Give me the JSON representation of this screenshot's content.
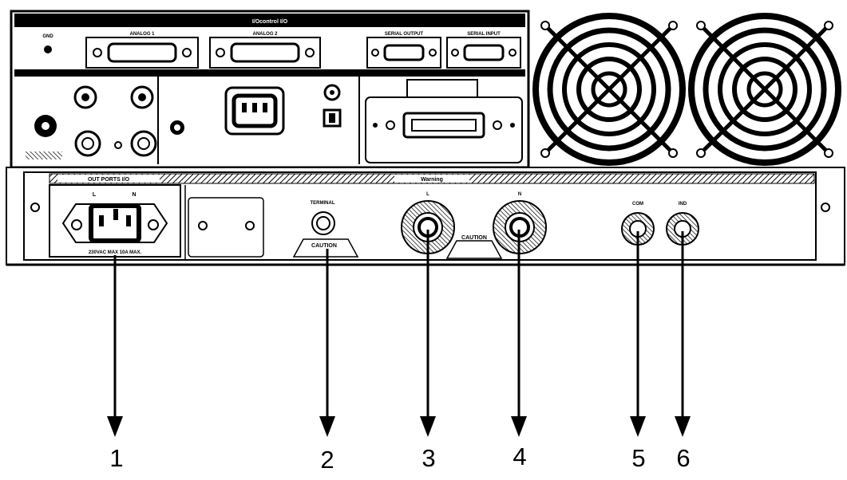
{
  "panel": {
    "top_bar_title": "I/Ocontrol I/O",
    "header_labels": [
      "ANALOG 1",
      "ANALOG 2",
      "SERIAL OUTPUT",
      "SERIAL INPUT"
    ],
    "lower_bar_left_label": "OUT PORTS I/O",
    "lower_bar_center_label": "Warning",
    "ln_labels": [
      "L",
      "N"
    ],
    "outlet_caption": "230VAC MAX 10A MAX.",
    "terminal_label": "TERMINAL",
    "caution_label": "CAUTION",
    "l_label": "L",
    "n_label": "N",
    "com_label": "COM",
    "ind_label": "IND"
  },
  "callouts": [
    {
      "number": "1"
    },
    {
      "number": "2"
    },
    {
      "number": "3"
    },
    {
      "number": "4"
    },
    {
      "number": "5"
    },
    {
      "number": "6"
    }
  ]
}
